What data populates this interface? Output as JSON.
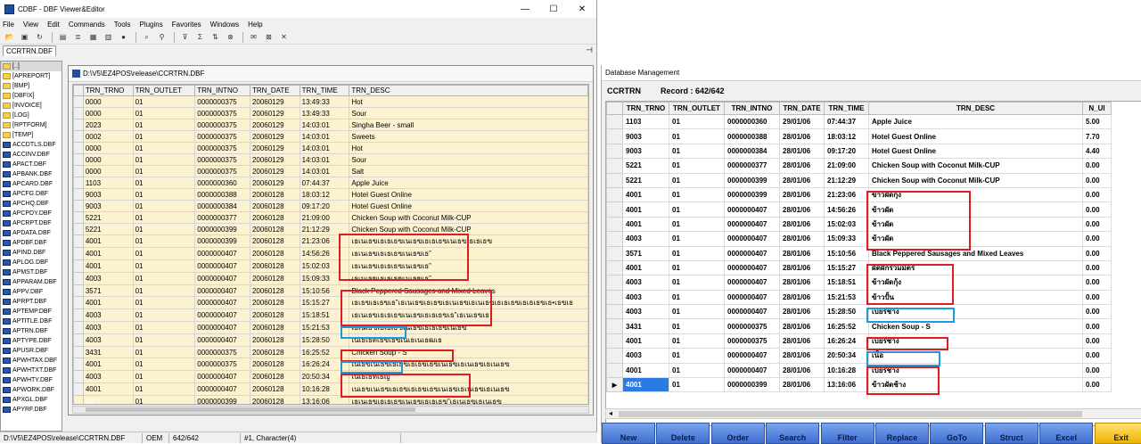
{
  "cdbf": {
    "title": "CDBF - DBF Viewer&Editor",
    "menu": [
      "File",
      "View",
      "Edit",
      "Commands",
      "Tools",
      "Plugins",
      "Favorites",
      "Windows",
      "Help"
    ],
    "tab_label": "CCRTRN.DBF",
    "window_controls": {
      "minimize": "—",
      "maximize": "☐",
      "close": "✕"
    },
    "toolbar_icons": [
      "open-folder-icon",
      "save-icon",
      "refresh-icon",
      "document-icon",
      "list-icon",
      "grid-icon",
      "view-icon",
      "info-icon",
      "search-icon",
      "binoculars-icon",
      "filter-icon",
      "sum-icon",
      "sort-icon",
      "clear-filter-icon",
      "mail-icon",
      "exit-icon",
      "close-icon"
    ],
    "file_tree": [
      {
        "label": "[..]",
        "kind": "folder"
      },
      {
        "label": "[APREPORT]",
        "kind": "folder"
      },
      {
        "label": "[BMP]",
        "kind": "folder"
      },
      {
        "label": "[DBFIX]",
        "kind": "folder"
      },
      {
        "label": "[INVOICE]",
        "kind": "folder"
      },
      {
        "label": "[LOG]",
        "kind": "folder"
      },
      {
        "label": "[RPTFORM]",
        "kind": "folder"
      },
      {
        "label": "[TEMP]",
        "kind": "folder"
      },
      {
        "label": "ACCDTLS.DBF",
        "kind": "dbf"
      },
      {
        "label": "ACCINV.DBF",
        "kind": "dbf"
      },
      {
        "label": "APACT.DBF",
        "kind": "dbf"
      },
      {
        "label": "APBANK.DBF",
        "kind": "dbf"
      },
      {
        "label": "APCARD.DBF",
        "kind": "dbf"
      },
      {
        "label": "APCFG.DBF",
        "kind": "dbf"
      },
      {
        "label": "APCHQ.DBF",
        "kind": "dbf"
      },
      {
        "label": "APCPDY.DBF",
        "kind": "dbf"
      },
      {
        "label": "APCRPT.DBF",
        "kind": "dbf"
      },
      {
        "label": "APDATA.DBF",
        "kind": "dbf"
      },
      {
        "label": "APDBF.DBF",
        "kind": "dbf"
      },
      {
        "label": "APIND.DBF",
        "kind": "dbf"
      },
      {
        "label": "APLOG.DBF",
        "kind": "dbf"
      },
      {
        "label": "APMST.DBF",
        "kind": "dbf"
      },
      {
        "label": "APPARAM.DBF",
        "kind": "dbf"
      },
      {
        "label": "APPV.DBF",
        "kind": "dbf"
      },
      {
        "label": "APRPT.DBF",
        "kind": "dbf"
      },
      {
        "label": "APTEMP.DBF",
        "kind": "dbf"
      },
      {
        "label": "APTITLE.DBF",
        "kind": "dbf"
      },
      {
        "label": "APTRN.DBF",
        "kind": "dbf"
      },
      {
        "label": "APTYPE.DBF",
        "kind": "dbf"
      },
      {
        "label": "APUSR.DBF",
        "kind": "dbf"
      },
      {
        "label": "APWHTAX.DBF",
        "kind": "dbf"
      },
      {
        "label": "APWHTXT.DBF",
        "kind": "dbf"
      },
      {
        "label": "APWHTY.DBF",
        "kind": "dbf"
      },
      {
        "label": "APWORK.DBF",
        "kind": "dbf"
      },
      {
        "label": "APXGL.DBF",
        "kind": "dbf"
      },
      {
        "label": "APYRF.DBF",
        "kind": "dbf"
      }
    ],
    "child_title": "D:\\V5\\EZ4POS\\release\\CCRTRN.DBF",
    "columns": [
      "TRN_TRNO",
      "TRN_OUTLET",
      "TRN_INTNO",
      "TRN_DATE",
      "TRN_TIME",
      "TRN_DESC"
    ],
    "rows": [
      [
        "0000",
        "01",
        "0000000375",
        "20060129",
        "13:49:33",
        "Hot"
      ],
      [
        "0000",
        "01",
        "0000000375",
        "20060129",
        "13:49:33",
        "Sour"
      ],
      [
        "2023",
        "01",
        "0000000375",
        "20060129",
        "14:03:01",
        "Singha Beer - small"
      ],
      [
        "0002",
        "01",
        "0000000375",
        "20060129",
        "14:03:01",
        "Sweets"
      ],
      [
        "0000",
        "01",
        "0000000375",
        "20060129",
        "14:03:01",
        "Hot"
      ],
      [
        "0000",
        "01",
        "0000000375",
        "20060129",
        "14:03:01",
        "Sour"
      ],
      [
        "0000",
        "01",
        "0000000375",
        "20060129",
        "14:03:01",
        "Salt"
      ],
      [
        "1103",
        "01",
        "0000000360",
        "20060129",
        "07:44:37",
        "Apple Juice"
      ],
      [
        "9003",
        "01",
        "0000000388",
        "20060128",
        "18:03:12",
        "Hotel Guest Online"
      ],
      [
        "9003",
        "01",
        "0000000384",
        "20060128",
        "09:17:20",
        "Hotel Guest Online"
      ],
      [
        "5221",
        "01",
        "0000000377",
        "20060128",
        "21:09:00",
        "Chicken Soup with Coconut Milk-CUP"
      ],
      [
        "5221",
        "01",
        "0000000399",
        "20060128",
        "21:12:29",
        "Chicken Soup with Coconut Milk-CUP"
      ],
      [
        "4001",
        "01",
        "0000000399",
        "20060128",
        "21:23:06",
        "เธเนเธฃเธเธเธฃเนเธฃเธเธเธฃเนเธฃเธเธเธฃ"
      ],
      [
        "4001",
        "01",
        "0000000407",
        "20060128",
        "14:56:26",
        "เธเนเธฃเธเธเธฃเนเธฃเธ”"
      ],
      [
        "4001",
        "01",
        "0000000407",
        "20060128",
        "15:02:03",
        "เธเนเธฃเธเธเธฃเนเธฃเธ”"
      ],
      [
        "4003",
        "01",
        "0000000407",
        "20060128",
        "15:09:33",
        "เธเนเธฃเธเธเธฃเนเธฃเธ”"
      ],
      [
        "3571",
        "01",
        "0000000407",
        "20060128",
        "15:10:56",
        "Black Peppered Sausages and Mixed Leaves"
      ],
      [
        "4001",
        "01",
        "0000000407",
        "20060128",
        "15:15:27",
        "เธเธฃเธเธฃเธ”เธเนเธฃเธเธฃเธเนเธฃเธเนเธฃเธเธเธฃเธเธเธฃเธ•เธฃเธ"
      ],
      [
        "4003",
        "01",
        "0000000407",
        "20060128",
        "15:18:51",
        "เธเนเธฃเธเธเธฃเนเธฃเธเธเธฃเธ”เธเนเธฃเธ"
      ],
      [
        "4003",
        "01",
        "0000000407",
        "20060128",
        "15:21:53",
        "เธเนเธฃเธเธเธฃเนเธฃเธเธเธฃเนเธฃ"
      ],
      [
        "4003",
        "01",
        "0000000407",
        "20060128",
        "15:28:50",
        "เนเธเธตเธขเธฃเนเธเนเธฒเธ"
      ],
      [
        "3431",
        "01",
        "0000000375",
        "20060128",
        "16:25:52",
        "Chicken Soup - S"
      ],
      [
        "4001",
        "01",
        "0000000375",
        "20060128",
        "16:26:24",
        "เนเธขเนเธฃเธเธฃเธเธขเธฃเนเธฃเธเนเธฃเธเนเธฃ"
      ],
      [
        "4003",
        "01",
        "0000000407",
        "20060128",
        "20:50:34",
        "เนเธเธทเธญ"
      ],
      [
        "4001",
        "01",
        "0000000407",
        "20060128",
        "10:16:28",
        "เนเธขเนเธฃเธเธฃเธเธขเธฃเนเธฃเธเนเธฃเธเนเธฃ"
      ],
      [
        "4001",
        "01",
        "0000000399",
        "20060128",
        "13:16:06",
        "เธเนเธฃเธเธเธฃเนเธฃเธเธเธฃ”เธเนเธฃเธเนเธฃ"
      ]
    ],
    "status": [
      "D:\\V5\\EZ4POS\\release\\CCRTRN.DBF",
      "OEM",
      "642/642",
      "#1, Character(4)"
    ]
  },
  "dbm": {
    "title": "Database Management",
    "table": "CCRTRN",
    "record": "Record : 642/642",
    "columns": [
      "TRN_TRNO",
      "TRN_OUTLET",
      "TRN_INTNO",
      "TRN_DATE",
      "TRN_TIME",
      "TRN_DESC",
      "N_UI"
    ],
    "rows": [
      [
        "1103",
        "01",
        "0000000360",
        "29/01/06",
        "07:44:37",
        "Apple Juice",
        "5.00"
      ],
      [
        "9003",
        "01",
        "0000000388",
        "28/01/06",
        "18:03:12",
        "Hotel Guest Online",
        "7.70"
      ],
      [
        "9003",
        "01",
        "0000000384",
        "28/01/06",
        "09:17:20",
        "Hotel Guest Online",
        "4.40"
      ],
      [
        "5221",
        "01",
        "0000000377",
        "28/01/06",
        "21:09:00",
        "Chicken Soup with Coconut Milk-CUP",
        "0.00"
      ],
      [
        "5221",
        "01",
        "0000000399",
        "28/01/06",
        "21:12:29",
        "Chicken Soup with Coconut Milk-CUP",
        "0.00"
      ],
      [
        "4001",
        "01",
        "0000000399",
        "28/01/06",
        "21:23:06",
        "ข้าวผัดกุ้ง",
        "0.00"
      ],
      [
        "4001",
        "01",
        "0000000407",
        "28/01/06",
        "14:56:26",
        "ข้าวผัด",
        "0.00"
      ],
      [
        "4001",
        "01",
        "0000000407",
        "28/01/06",
        "15:02:03",
        "ข้าวผัด",
        "0.00"
      ],
      [
        "4003",
        "01",
        "0000000407",
        "28/01/06",
        "15:09:33",
        "ข้าวผัด",
        "0.00"
      ],
      [
        "3571",
        "01",
        "0000000407",
        "28/01/06",
        "15:10:56",
        "Black Peppered Sausages and Mixed Leaves",
        "0.00"
      ],
      [
        "4001",
        "01",
        "0000000407",
        "28/01/06",
        "15:15:27",
        "ผัดผักรวมมิตร",
        "0.00"
      ],
      [
        "4003",
        "01",
        "0000000407",
        "28/01/06",
        "15:18:51",
        "ข้าวผัดกุ้ง",
        "0.00"
      ],
      [
        "4003",
        "01",
        "0000000407",
        "28/01/06",
        "15:21:53",
        "ข้าวปั้น",
        "0.00"
      ],
      [
        "4003",
        "01",
        "0000000407",
        "28/01/06",
        "15:28:50",
        "เบียร์ช้าง",
        "0.00"
      ],
      [
        "3431",
        "01",
        "0000000375",
        "28/01/06",
        "16:25:52",
        "Chicken Soup - S",
        "0.00"
      ],
      [
        "4001",
        "01",
        "0000000375",
        "28/01/06",
        "16:26:24",
        "เบียร์ช้าง",
        "0.00"
      ],
      [
        "4003",
        "01",
        "0000000407",
        "28/01/06",
        "20:50:34",
        "เนื้อ",
        "0.00"
      ],
      [
        "4001",
        "01",
        "0000000407",
        "28/01/06",
        "10:16:28",
        "เบียร์ช้าง",
        "0.00"
      ],
      [
        "4001",
        "01",
        "0000000399",
        "28/01/06",
        "13:16:06",
        "ข้าวผัดช้าง",
        "0.00"
      ]
    ],
    "buttons": [
      "New",
      "Delete",
      "Order",
      "Search",
      "Filter",
      "Replace",
      "GoTo",
      "Struct",
      "Excel",
      "Exit"
    ]
  }
}
